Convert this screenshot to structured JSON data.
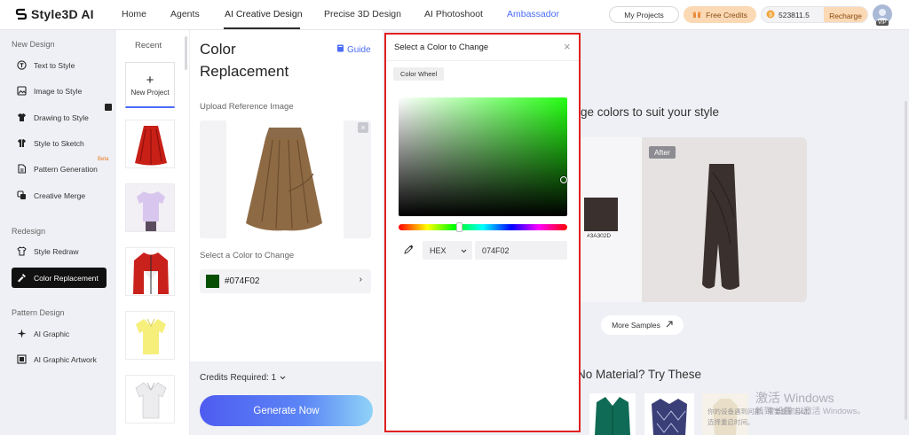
{
  "app": {
    "name": "Style3D AI"
  },
  "nav": {
    "links": [
      "Home",
      "Agents",
      "AI Creative Design",
      "Precise 3D Design",
      "AI Photoshoot",
      "Ambassador"
    ],
    "my_projects": "My Projects",
    "free_credits": "Free Credits",
    "credits_balance": "523811.5",
    "recharge": "Recharge",
    "vip": "VIP"
  },
  "sidebar": {
    "sections": [
      {
        "title": "New Design",
        "items": [
          "Text to Style",
          "Image to Style",
          "Drawing to Style",
          "Style to Sketch",
          "Pattern Generation",
          "Creative Merge"
        ]
      },
      {
        "title": "Redesign",
        "items": [
          "Style Redraw",
          "Color Replacement"
        ]
      },
      {
        "title": "Pattern Design",
        "items": [
          "AI Graphic",
          "AI Graphic Artwork"
        ]
      }
    ],
    "beta_badge": "Beta"
  },
  "recent": {
    "title": "Recent",
    "new_project": "New Project",
    "plus": "+"
  },
  "config": {
    "title_line1": "Color",
    "title_line2": "Replacement",
    "guide": "Guide",
    "upload_label": "Upload Reference Image",
    "select_color_label": "Select a Color to Change",
    "selected_color": "#074F02",
    "credits_required": "Credits Required: 1",
    "generate_button": "Generate Now"
  },
  "dialog": {
    "title": "Select a Color to Change",
    "close": "×",
    "tab": "Color Wheel",
    "format": "HEX",
    "hex_value": "074F02",
    "hue": 0.36
  },
  "preview": {
    "headline_partial": "ge colors to suit your style",
    "after_badge": "After",
    "swatch_label": "#3A302D",
    "more_samples": "More Samples",
    "no_material_partial": "No Material? Try These"
  },
  "watermark": {
    "line1": "激活 Windows",
    "line2": "转到\"设置\"以激活 Windows。",
    "line3": "你的设备遇到问题，需要重新启动。",
    "line4": "选择重启时间。"
  },
  "colors": {
    "accent_blue": "#4a6cf7",
    "selected_green": "#074F02",
    "dialog_border": "#e02020",
    "brown_swatch": "#3A302D"
  }
}
